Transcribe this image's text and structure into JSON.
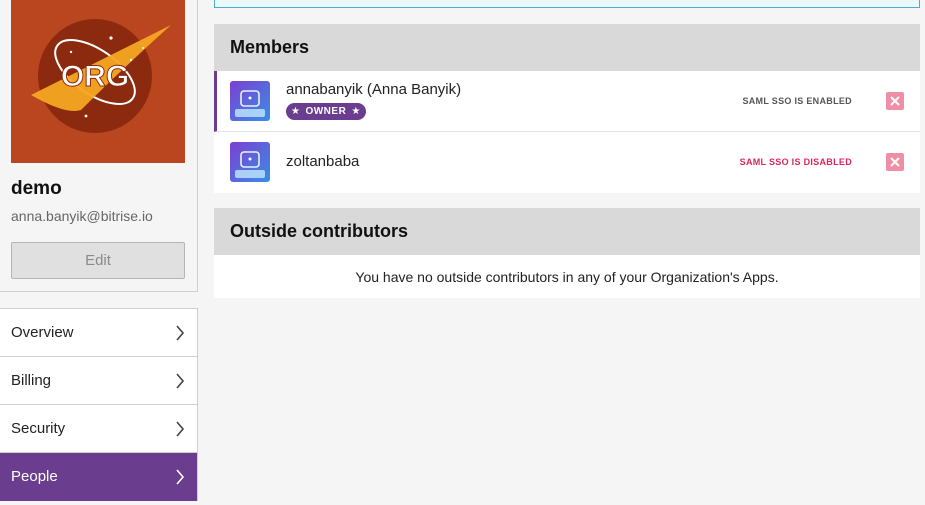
{
  "profile": {
    "logo_text": "ORG",
    "org_name": "demo",
    "email": "anna.banyik@bitrise.io",
    "edit_label": "Edit"
  },
  "nav": {
    "items": [
      {
        "label": "Overview",
        "active": false
      },
      {
        "label": "Billing",
        "active": false
      },
      {
        "label": "Security",
        "active": false
      },
      {
        "label": "People",
        "active": true
      }
    ]
  },
  "members": {
    "title": "Members",
    "rows": [
      {
        "name": "annabanyik (Anna Banyik)",
        "badge": "OWNER",
        "sso_status": "SAML SSO IS ENABLED",
        "sso_enabled": true
      },
      {
        "name": "zoltanbaba",
        "badge": "",
        "sso_status": "SAML SSO IS DISABLED",
        "sso_enabled": false
      }
    ]
  },
  "outside": {
    "title": "Outside contributors",
    "empty_message": "You have no outside contributors in any of your Organization's Apps."
  },
  "colors": {
    "accent": "#6a3d8f",
    "logo_bg": "#b9461e",
    "sso_disabled": "#e0245e",
    "remove": "#f08ea6"
  }
}
